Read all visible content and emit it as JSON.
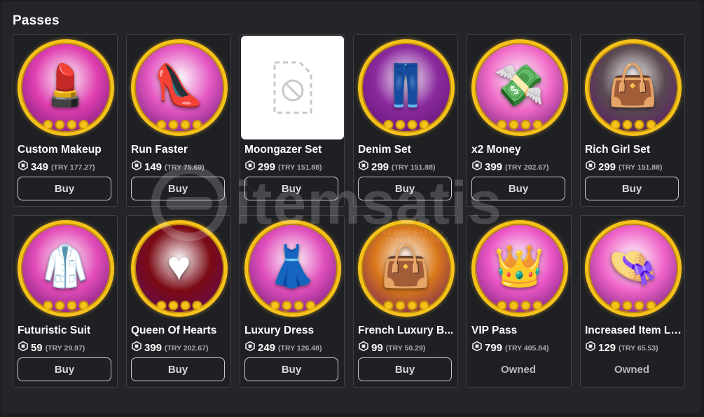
{
  "section": {
    "title": "Passes"
  },
  "robux_icon": "robux-hexagon-icon",
  "accent_color": "#f5c21a",
  "passes": [
    {
      "name": "Custom Makeup",
      "price": "349",
      "try": "(TRY 177.27)",
      "action": "Buy",
      "owned": false,
      "icon": "makeup-girl-icon",
      "bg": "#e040b0",
      "art": "💄"
    },
    {
      "name": "Run Faster",
      "price": "149",
      "try": "(TRY 75.69)",
      "action": "Buy",
      "owned": false,
      "icon": "high-heel-icon",
      "bg": "#e458c2",
      "art": "👠"
    },
    {
      "name": "Moongazer Set",
      "price": "299",
      "try": "(TRY 151.88)",
      "action": "Buy",
      "owned": false,
      "icon": "unavailable-image-icon",
      "bg": "#ffffff",
      "art": ""
    },
    {
      "name": "Denim Set",
      "price": "299",
      "try": "(TRY 151.88)",
      "action": "Buy",
      "owned": false,
      "icon": "denim-outfit-icon",
      "bg": "#8a2a9e",
      "art": "👖"
    },
    {
      "name": "x2 Money",
      "price": "399",
      "try": "(TRY 202.67)",
      "action": "Buy",
      "owned": false,
      "icon": "money-icon",
      "bg": "#f06cc8",
      "art": "💸"
    },
    {
      "name": "Rich Girl Set",
      "price": "299",
      "try": "(TRY 151.88)",
      "action": "Buy",
      "owned": false,
      "icon": "rich-girl-icon",
      "bg": "#5a4a52",
      "art": "👜"
    },
    {
      "name": "Futuristic Suit",
      "price": "59",
      "try": "(TRY 29.97)",
      "action": "Buy",
      "owned": false,
      "icon": "suit-icon",
      "bg": "#e24cb8",
      "art": "🥼"
    },
    {
      "name": "Queen Of Hearts",
      "price": "399",
      "try": "(TRY 202.67)",
      "action": "Buy",
      "owned": false,
      "icon": "queen-hearts-icon",
      "bg": "#7a0a14",
      "art": "♥"
    },
    {
      "name": "Luxury Dress",
      "price": "249",
      "try": "(TRY 126.48)",
      "action": "Buy",
      "owned": false,
      "icon": "dress-icon",
      "bg": "#e050bc",
      "art": "👗"
    },
    {
      "name": "French Luxury B...",
      "price": "99",
      "try": "(TRY 50.29)",
      "action": "Buy",
      "owned": false,
      "icon": "handbag-icon",
      "bg": "#d9781a",
      "art": "👜"
    },
    {
      "name": "VIP Pass",
      "price": "799",
      "try": "(TRY 405.84)",
      "action": "Owned",
      "owned": true,
      "icon": "vip-crown-icon",
      "bg": "#ec58c6",
      "art": "👑"
    },
    {
      "name": "Increased Item Li...",
      "price": "129",
      "try": "(TRY 65.53)",
      "action": "Owned",
      "owned": true,
      "icon": "hat-shirt-icon",
      "bg": "#ef64c8",
      "art": "👒"
    }
  ],
  "watermark": {
    "text": "itemsatis",
    "sub": "HESAP SATIN / ITEMSATIS.COM"
  }
}
